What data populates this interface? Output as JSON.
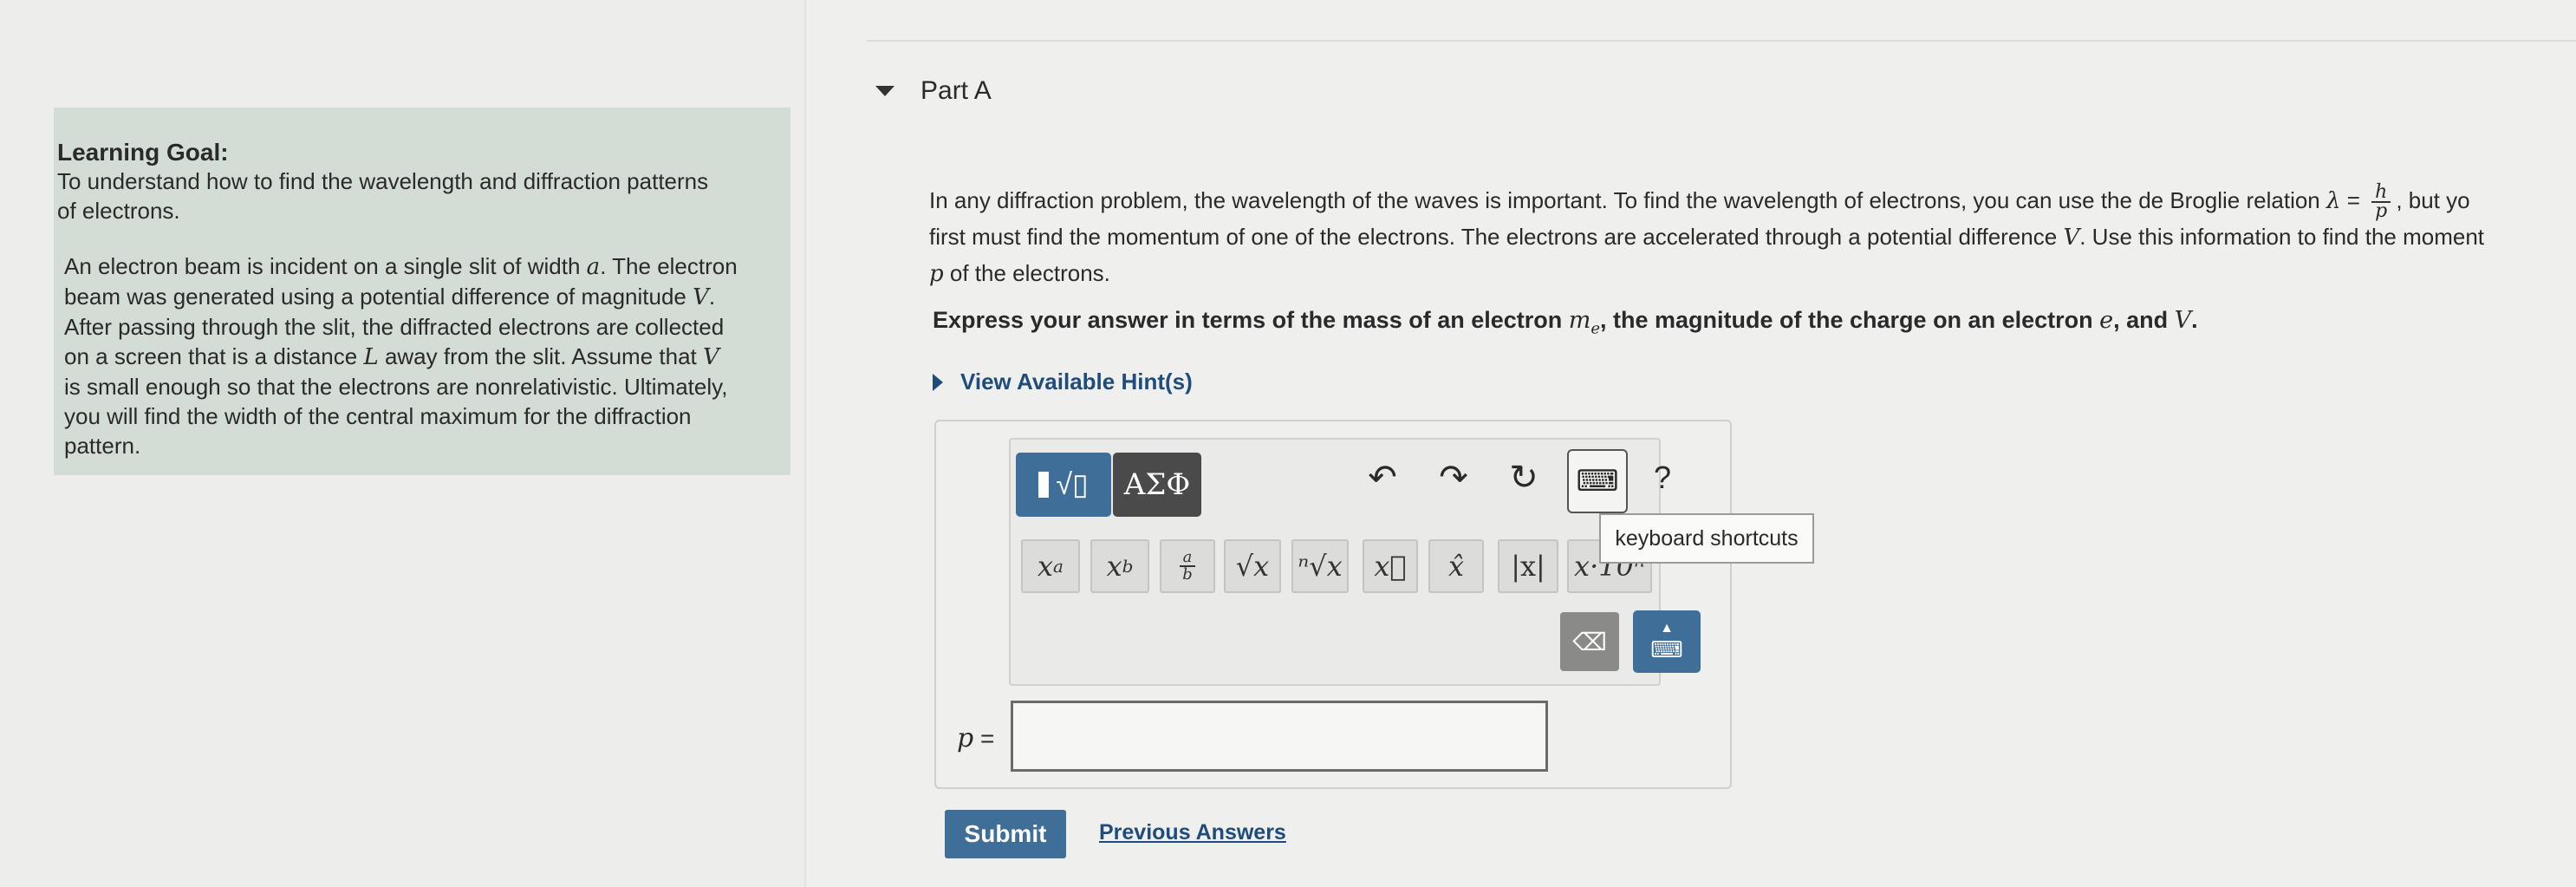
{
  "learning_goal": {
    "title": "Learning Goal:",
    "goal_line1": "To understand how to find the wavelength and diffraction patterns",
    "goal_line2": "of electrons.",
    "desc_lines": [
      "An electron beam is incident on a single slit of width",
      "a",
      ". The electron",
      "beam was generated using a potential difference of magnitude",
      "V",
      ".",
      "After passing through the slit, the diffracted electrons are collected",
      "on a screen that is a distance",
      "L",
      "away from the slit. Assume that",
      "V",
      "is small enough so that the electrons are nonrelativistic. Ultimately,",
      "you will find the width of the central maximum for the diffraction",
      "pattern."
    ]
  },
  "part": {
    "title": "Part A"
  },
  "question": {
    "l1a": "In any diffraction problem, the wavelength of the waves is important. To find the wavelength of electrons, you can use the de Broglie relation",
    "lambda": "λ",
    "eq": "=",
    "frac_num": "h",
    "frac_den": "p",
    "l1b": ", but yo",
    "l2a": "first must find the momentum of one of the electrons. The electrons are accelerated through a potential difference",
    "l2v": "V",
    "l2b": ". Use this information to find the moment",
    "l3p": "p",
    "l3b": "of the electrons."
  },
  "instruction": {
    "a": "Express your answer in terms of the mass of an electron",
    "me": "m",
    "me_sub": "e",
    "b": ", the magnitude of the charge on an electron",
    "e": "e",
    "c": ", and",
    "v": "V",
    "d": "."
  },
  "hints": {
    "label": "View Available Hint(s)"
  },
  "toolbar": {
    "templates_tab_glyph": "√▯",
    "greek_tab": "ΑΣΦ",
    "undo": "↶",
    "redo": "↷",
    "reset": "↻",
    "keyboard_icon": "⌨",
    "help": "?",
    "tooltip": "keyboard shortcuts",
    "buttons": [
      {
        "base": "x",
        "sup": "a"
      },
      {
        "base": "x",
        "sub": "b"
      },
      {
        "num": "a",
        "den": "b"
      },
      {
        "label": "√x"
      },
      {
        "label": "ⁿ√x"
      },
      {
        "label": "x⃗"
      },
      {
        "label": "x̂"
      },
      {
        "label": "|x|"
      },
      {
        "label": "x·10ⁿ"
      }
    ],
    "backspace": "⌫",
    "keyboard_toggle": "⌨"
  },
  "answer": {
    "label": "p",
    "eq": "=",
    "value": ""
  },
  "actions": {
    "submit": "Submit",
    "previous": "Previous Answers"
  }
}
